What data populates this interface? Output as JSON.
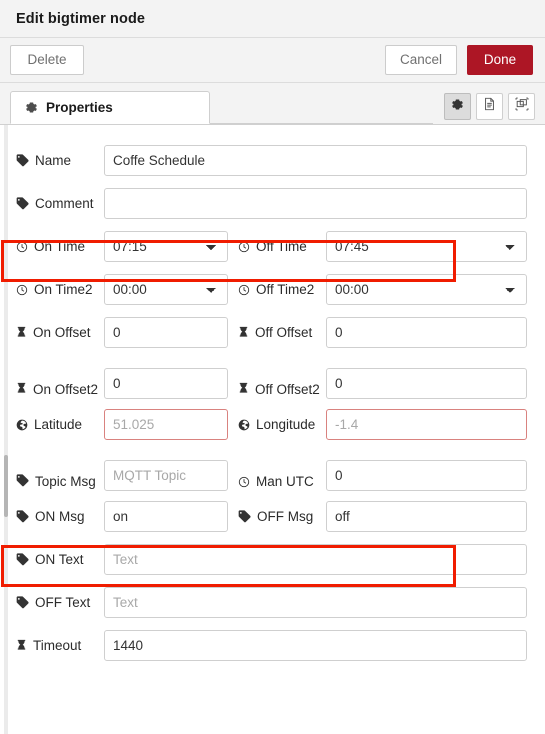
{
  "header": {
    "title": "Edit bigtimer node"
  },
  "toolbar": {
    "delete_label": "Delete",
    "cancel_label": "Cancel",
    "done_label": "Done",
    "done_color": "#ad1625"
  },
  "tabs": {
    "properties_label": "Properties",
    "icon_buttons": [
      {
        "name": "gear-icon",
        "active": true
      },
      {
        "name": "document-icon",
        "active": false
      },
      {
        "name": "appearance-icon",
        "active": false
      }
    ]
  },
  "annotations": {
    "highlight_color": "#f01c00",
    "boxes": [
      {
        "label": "on-time-off-time-row"
      },
      {
        "label": "on-msg-off-msg-row"
      }
    ]
  },
  "form": {
    "name": {
      "label": "Name",
      "icon": "tag-icon",
      "value": "Coffe Schedule",
      "placeholder": ""
    },
    "comment": {
      "label": "Comment",
      "icon": "tag-icon",
      "value": "",
      "placeholder": ""
    },
    "on_time": {
      "label": "On Time",
      "icon": "clock-icon",
      "value": "07:15"
    },
    "off_time": {
      "label": "Off Time",
      "icon": "clock-icon",
      "value": "07:45"
    },
    "on_time2": {
      "label": "On Time2",
      "icon": "clock-icon",
      "value": "00:00"
    },
    "off_time2": {
      "label": "Off Time2",
      "icon": "clock-icon",
      "value": "00:00"
    },
    "on_offset": {
      "label": "On Offset",
      "icon": "hourglass-icon",
      "value": "0"
    },
    "off_offset": {
      "label": "Off Offset",
      "icon": "hourglass-icon",
      "value": "0"
    },
    "on_offset2": {
      "label": "On Offset2",
      "icon": "hourglass-icon",
      "value": "0"
    },
    "off_offset2": {
      "label": "Off Offset2",
      "icon": "hourglass-icon",
      "value": "0"
    },
    "latitude": {
      "label": "Latitude",
      "icon": "globe-icon",
      "value": "",
      "placeholder": "51.025",
      "invalid": true
    },
    "longitude": {
      "label": "Longitude",
      "icon": "globe-icon",
      "value": "",
      "placeholder": "-1.4",
      "invalid": true
    },
    "topic_msg": {
      "label": "Topic Msg",
      "icon": "tag-icon",
      "value": "",
      "placeholder": "MQTT Topic"
    },
    "man_utc": {
      "label": "Man UTC",
      "icon": "clock-icon",
      "value": "0"
    },
    "on_msg": {
      "label": "ON Msg",
      "icon": "tag-icon",
      "value": "on"
    },
    "off_msg": {
      "label": "OFF Msg",
      "icon": "tag-icon",
      "value": "off"
    },
    "on_text": {
      "label": "ON Text",
      "icon": "tag-icon",
      "value": "",
      "placeholder": "Text"
    },
    "off_text": {
      "label": "OFF Text",
      "icon": "tag-icon",
      "value": "",
      "placeholder": "Text"
    },
    "timeout": {
      "label": "Timeout",
      "icon": "hourglass-icon",
      "value": "1440"
    }
  }
}
